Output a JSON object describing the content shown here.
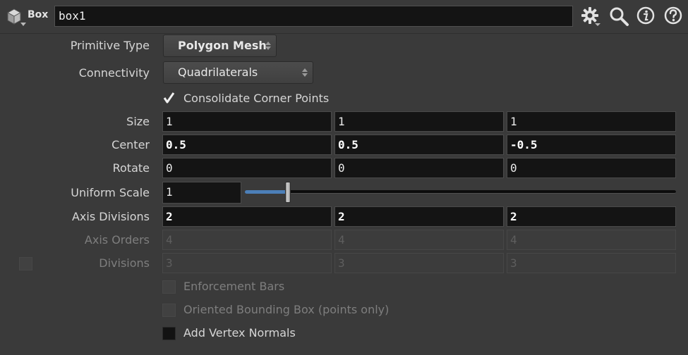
{
  "header": {
    "node_type": "Box",
    "node_name": "box1",
    "icons": [
      "box-node-icon",
      "gear-icon",
      "search-icon",
      "info-icon",
      "help-icon"
    ]
  },
  "primitive_type": {
    "label": "Primitive Type",
    "value": "Polygon Mesh"
  },
  "connectivity": {
    "label": "Connectivity",
    "value": "Quadrilaterals"
  },
  "consolidate": {
    "label": "Consolidate Corner Points",
    "checked": true
  },
  "size": {
    "label": "Size",
    "x": "1",
    "y": "1",
    "z": "1"
  },
  "center": {
    "label": "Center",
    "x": "0.5",
    "y": "0.5",
    "z": "-0.5"
  },
  "rotate": {
    "label": "Rotate",
    "x": "0",
    "y": "0",
    "z": "0"
  },
  "uniform_scale": {
    "label": "Uniform Scale",
    "value": "1",
    "slider_fraction": 0.1
  },
  "axis_divisions": {
    "label": "Axis Divisions",
    "x": "2",
    "y": "2",
    "z": "2"
  },
  "axis_orders": {
    "label": "Axis Orders",
    "x": "4",
    "y": "4",
    "z": "4"
  },
  "divisions": {
    "label": "Divisions",
    "x": "3",
    "y": "3",
    "z": "3",
    "enabled": false
  },
  "enforcement_bars": {
    "label": "Enforcement Bars",
    "checked": false
  },
  "oriented_bbox": {
    "label": "Oriented Bounding Box (points only)",
    "checked": false
  },
  "vertex_normals": {
    "label": "Add Vertex Normals",
    "checked": false
  },
  "colors": {
    "background": "#3a3a3a",
    "field_bg": "#141414",
    "slider_fill": "#4c7fb8"
  }
}
